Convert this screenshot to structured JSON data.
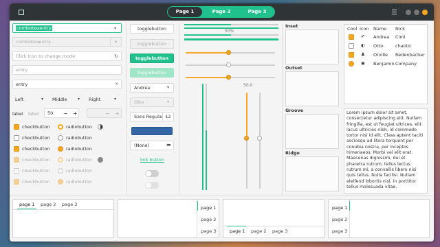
{
  "headerbar": {
    "pages": [
      "Page 1",
      "Page 2",
      "Page 3"
    ],
    "selected_page": "Page 1",
    "accent": "#21c18d"
  },
  "entries": {
    "combo1": "comboboxentry",
    "combo2": "comboboxentry",
    "iconmode": "Click icon to change mode",
    "entry_ph": "entry",
    "entry_val": "entry",
    "align": [
      "Left",
      "Middle",
      "Right"
    ]
  },
  "spin": {
    "label1": "label",
    "label2": "label",
    "value": "50",
    "minus": "−",
    "plus": "+"
  },
  "checks": [
    "checkbutton",
    "checkbutton",
    "checkbutton",
    "checkbutton",
    "checkbutton",
    "checkbutton"
  ],
  "radios": [
    "radiobutton",
    "radiobutton",
    "radiobutton",
    "radiobutton",
    "radiobutton",
    "radiobutton"
  ],
  "buttons": {
    "toggle": "togglebutton",
    "combo_name": "Andrea",
    "combo_dis": "Otto",
    "font": "Sans Regular",
    "font_size": "12",
    "file": "(None)",
    "link": "link button"
  },
  "levels": {
    "progress_label": "50%",
    "scale_label": "50.0"
  },
  "frames": [
    "Inset",
    "Outset",
    "Groove",
    "Ridge"
  ],
  "tree": {
    "headers": [
      "Cool",
      "Icon",
      "Name",
      "Nick"
    ],
    "rows": [
      [
        "Andrea",
        "Cimi"
      ],
      [
        "Otto",
        "chaotic"
      ],
      [
        "Orville",
        "Redenbacher"
      ],
      [
        "Benjamin",
        "Company"
      ]
    ]
  },
  "textview": "Lorem ipsum dolor sit amet, consectetur adipiscing elit. Nullam fringilla, est ut feugiat ultrices, elit lacus ultricies nibh, id commodo tortor nisi id elit. Class aptent taciti sociosqu ad litora torquent per conubia nostra, per inceptos himenaeos. Morbi vel elit erat. Maecenas dignissim, dui et pharetra rutrum, tellus lectus rutrum mi, a convallis libero nisi quis tellus. Nulla facilisi. Nullam eleifend lobortis nisl, in porttitor tellus malesuada vitae.",
  "notebook": {
    "tabs": [
      "page 1",
      "page 2",
      "page 3"
    ]
  }
}
